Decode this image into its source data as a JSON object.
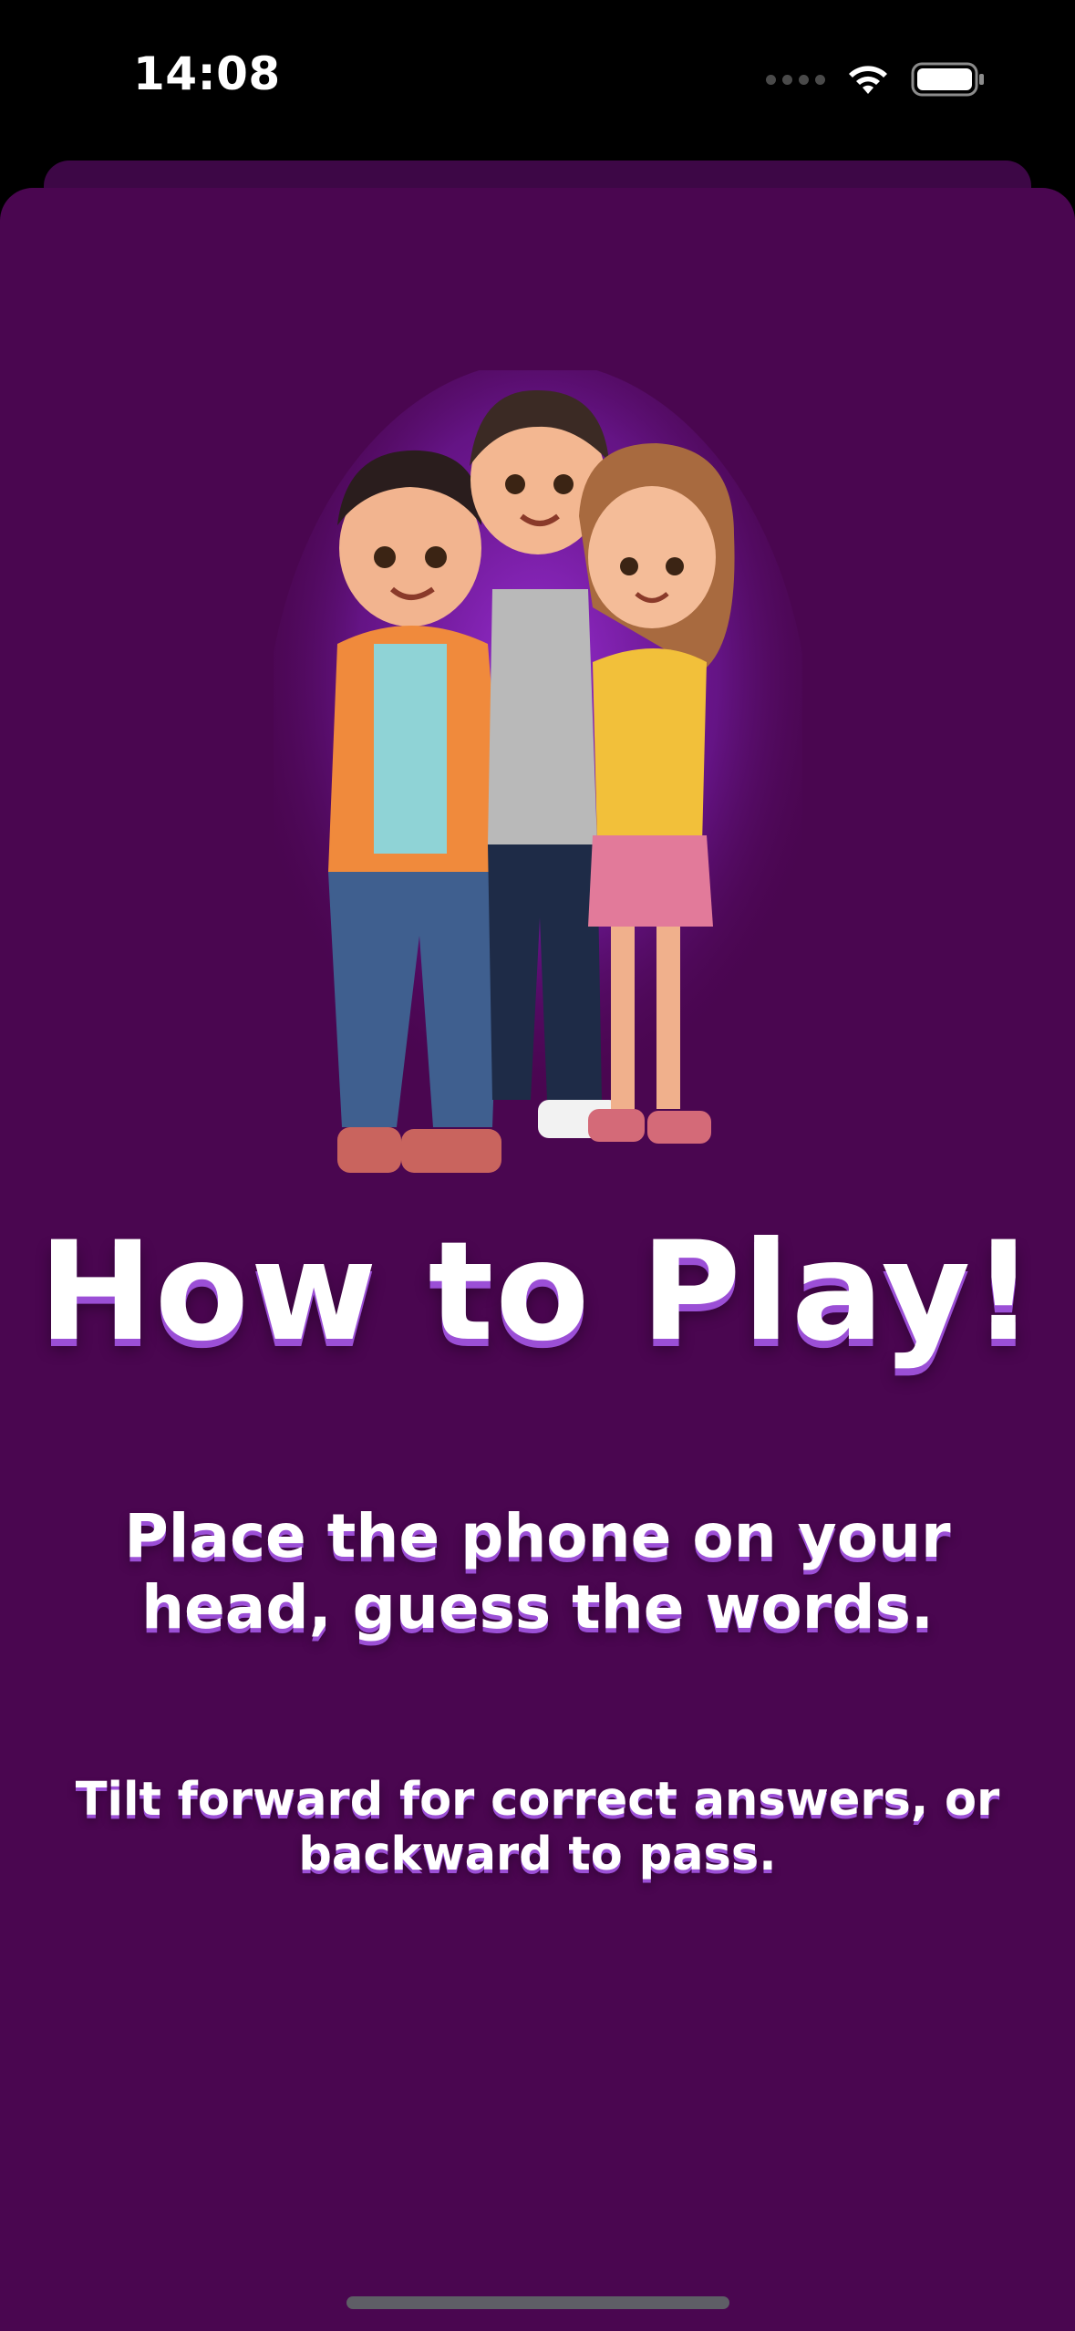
{
  "status_bar": {
    "time": "14:08",
    "icons": [
      "signal-dots-icon",
      "wifi-icon",
      "battery-icon"
    ]
  },
  "theme": {
    "background": "#4a0650",
    "sheet_back": "#3d0746",
    "text": "#ffffff",
    "text_shadow": "#9b4fd6"
  },
  "content": {
    "illustration": "three-kids-hugging-illustration",
    "title": "How to Play!",
    "instruction_1": "Place the phone on your head, guess the words.",
    "instruction_2": "Tilt forward for correct answers, or backward to pass."
  }
}
